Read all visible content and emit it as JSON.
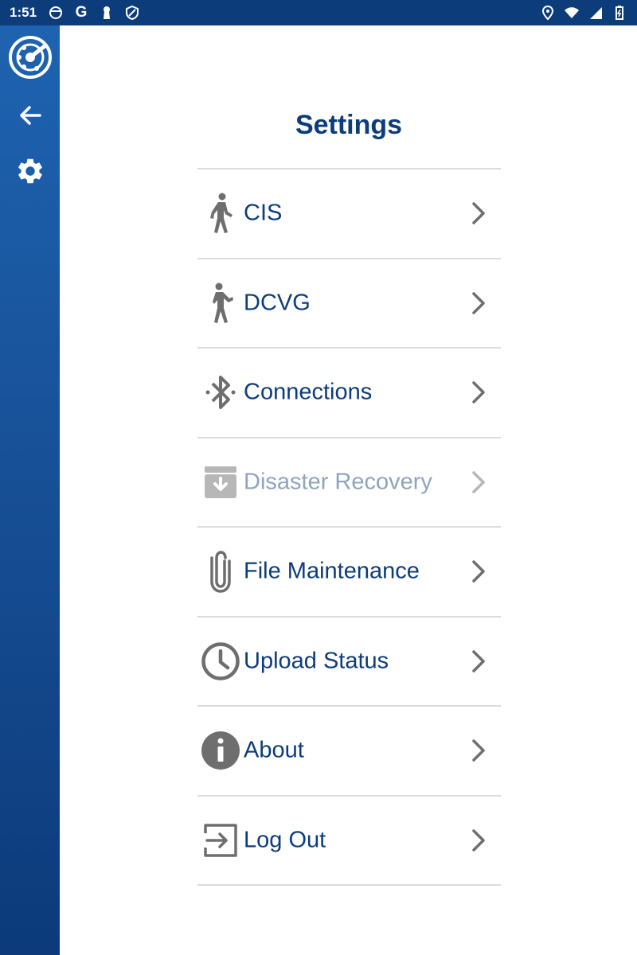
{
  "status_bar": {
    "time": "1:51",
    "left_icons": [
      "app-circle-icon",
      "google-icon",
      "keyhole-icon",
      "shield-icon"
    ],
    "right_icons": [
      "location-icon",
      "wifi-icon",
      "signal-icon",
      "battery-icon"
    ]
  },
  "sidebar": {
    "items": [
      {
        "name": "app-logo-icon"
      },
      {
        "name": "back-arrow-icon"
      },
      {
        "name": "gear-icon"
      }
    ]
  },
  "page": {
    "title": "Settings"
  },
  "menu": {
    "items": [
      {
        "label": "CIS",
        "icon": "walking-person-icon",
        "enabled": true
      },
      {
        "label": "DCVG",
        "icon": "walking-person-icon",
        "enabled": true
      },
      {
        "label": "Connections",
        "icon": "bluetooth-icon",
        "enabled": true
      },
      {
        "label": "Disaster Recovery",
        "icon": "archive-download-icon",
        "enabled": false
      },
      {
        "label": "File Maintenance",
        "icon": "paperclip-icon",
        "enabled": true
      },
      {
        "label": "Upload Status",
        "icon": "clock-icon",
        "enabled": true
      },
      {
        "label": "About",
        "icon": "info-icon",
        "enabled": true
      },
      {
        "label": "Log Out",
        "icon": "exit-icon",
        "enabled": true
      }
    ]
  },
  "colors": {
    "status_bar": "#0c3c7a",
    "sidebar_top": "#1e63b1",
    "sidebar_bottom": "#0c3a7a",
    "primary_text": "#0c3c7a",
    "icon_gray": "#6e6e6e",
    "disabled_text": "#8ea4bf",
    "disabled_icon": "#b7b7b7",
    "divider": "#dcdcdc"
  }
}
